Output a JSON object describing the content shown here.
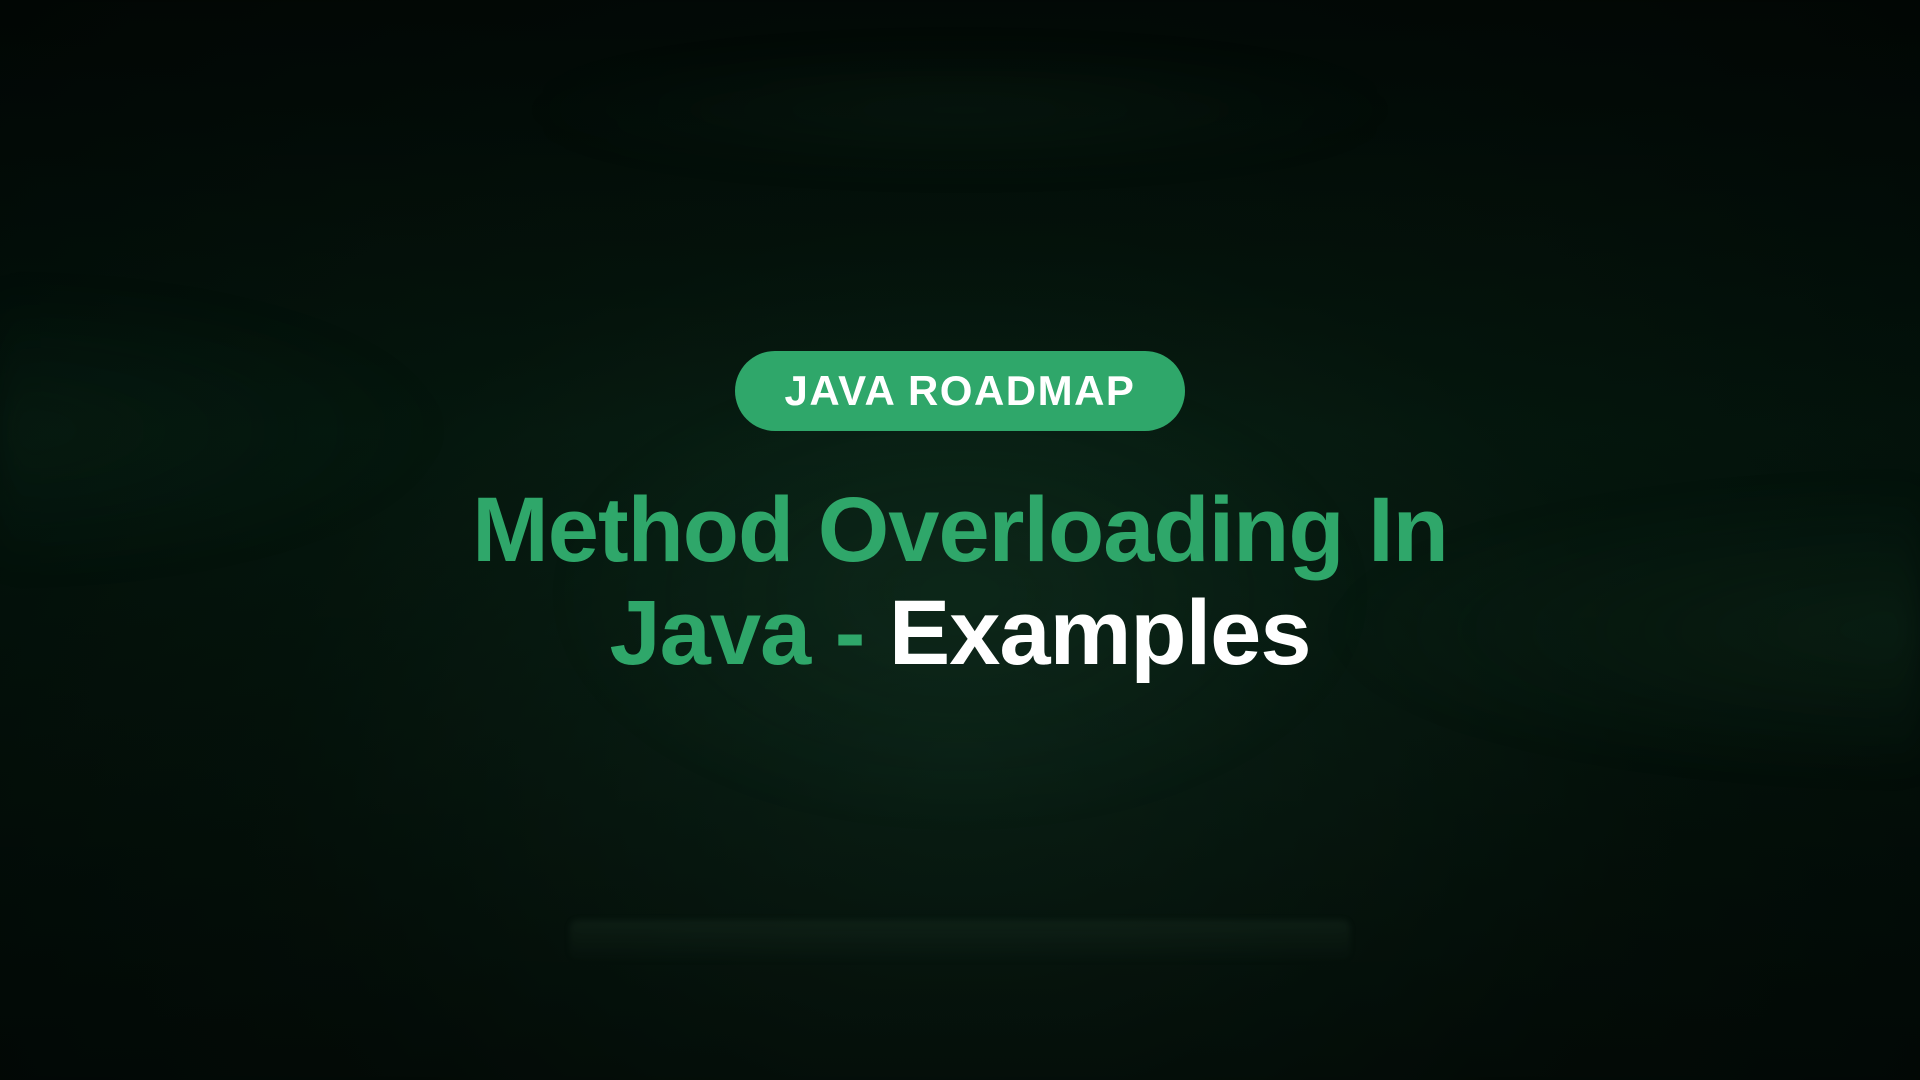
{
  "badge": "JAVA ROADMAP",
  "title": {
    "line1": "Method Overloading In",
    "line2_green": "Java - ",
    "line2_white": "Examples"
  },
  "colors": {
    "accent_green": "#2fa76a",
    "text_white": "#ffffff",
    "bg_dark": "#0a1f15"
  }
}
